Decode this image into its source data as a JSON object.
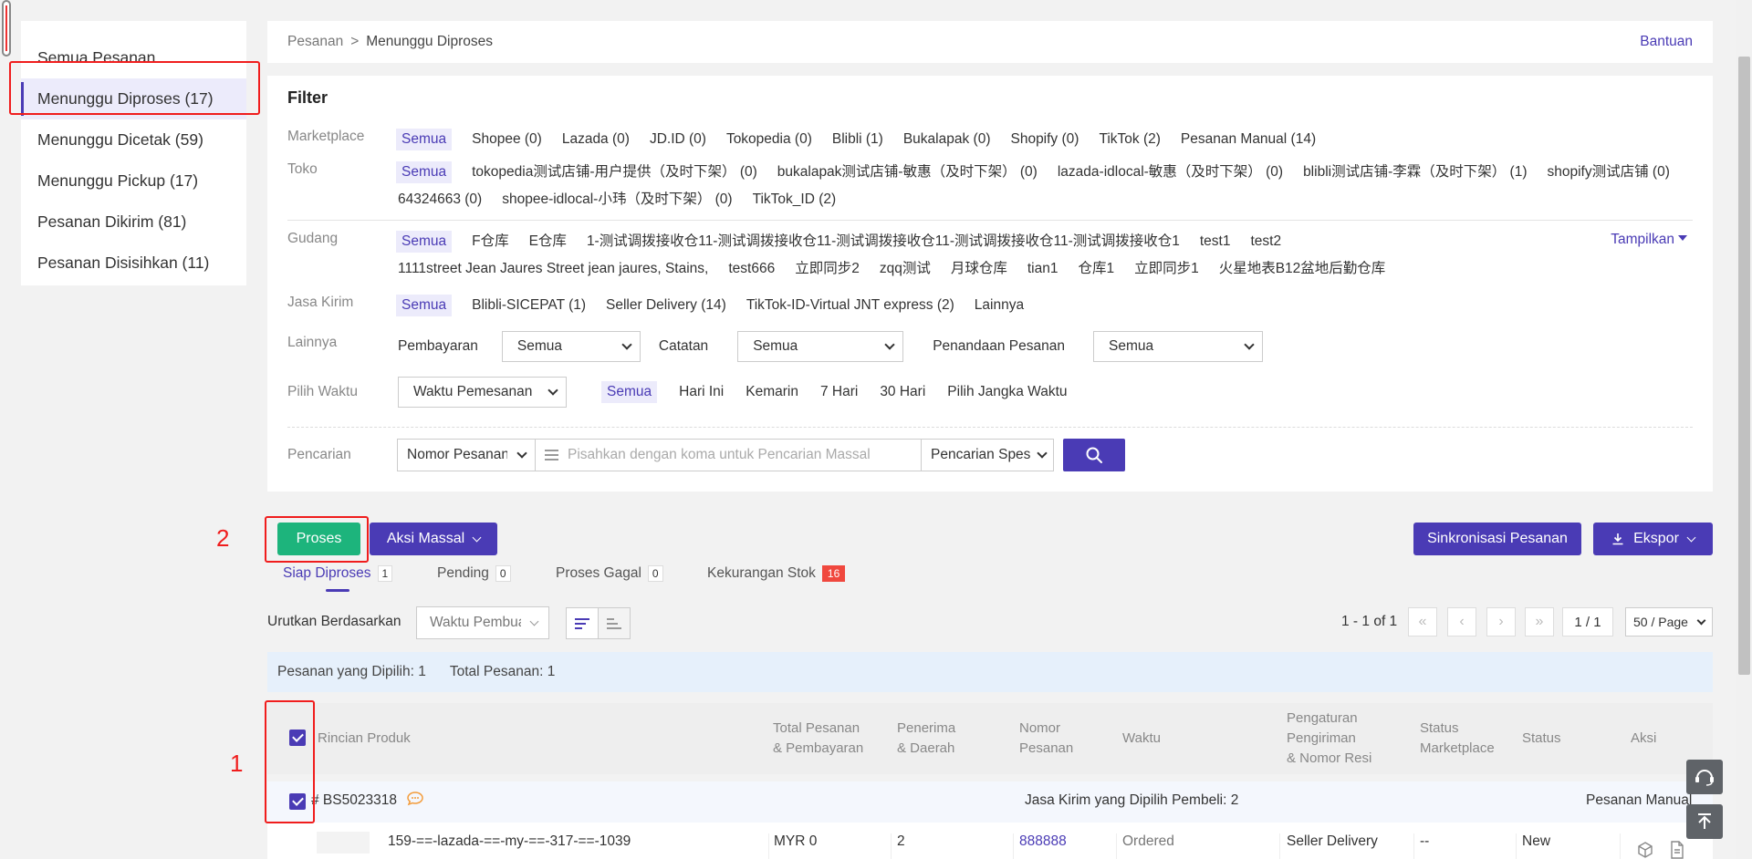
{
  "sidebar": {
    "items": [
      {
        "label": "Semua Pesanan"
      },
      {
        "label": "Menunggu Diproses (17)"
      },
      {
        "label": "Menunggu Dicetak (59)"
      },
      {
        "label": "Menunggu Pickup (17)"
      },
      {
        "label": "Pesanan Dikirim (81)"
      },
      {
        "label": "Pesanan Disisihkan (11)"
      }
    ],
    "active_index": 1
  },
  "breadcrumb": {
    "root": "Pesanan",
    "separator": ">",
    "current": "Menunggu Diproses",
    "help": "Bantuan"
  },
  "filter": {
    "title": "Filter",
    "marketplace": {
      "label": "Marketplace",
      "options": [
        "Semua",
        "Shopee (0)",
        "Lazada (0)",
        "JD.ID (0)",
        "Tokopedia (0)",
        "Blibli (1)",
        "Bukalapak (0)",
        "Shopify (0)",
        "TikTok (2)",
        "Pesanan Manual (14)"
      ]
    },
    "toko": {
      "label": "Toko",
      "options": [
        "Semua",
        "tokopedia测试店铺-用户提供（及时下架） (0)",
        "bukalapak测试店铺-敏惠（及时下架） (0)",
        "lazada-idlocal-敏惠（及时下架） (0)",
        "blibli测试店铺-李霖（及时下架） (1)",
        "shopify测试店铺 (0)",
        "64324663 (0)",
        "shopee-idlocal-小玮（及时下架） (0)",
        "TikTok_ID (2)"
      ]
    },
    "gudang": {
      "label": "Gudang",
      "options": [
        "Semua",
        "F仓库",
        "E仓库",
        "1-测试调拨接收仓11-测试调拨接收仓11-测试调拨接收仓11-测试调拨接收仓11-测试调拨接收仓1",
        "test1",
        "test2",
        "1111street Jean Jaures Street jean jaures, Stains,",
        "test666",
        "立即同步2",
        "zqq测试",
        "月球仓库",
        "tian1",
        "仓库1",
        "立即同步1",
        "火星地表B12盆地后勤仓库"
      ],
      "show_more": "Tampilkan"
    },
    "jasa_kirim": {
      "label": "Jasa Kirim",
      "options": [
        "Semua",
        "Blibli-SICEPAT (1)",
        "Seller Delivery (14)",
        "TikTok-ID-Virtual JNT express (2)",
        "Lainnya"
      ]
    },
    "lainnya": {
      "label": "Lainnya",
      "pembayaran_label": "Pembayaran",
      "pembayaran_value": "Semua",
      "catatan_label": "Catatan",
      "catatan_value": "Semua",
      "penandaan_label": "Penandaan Pesanan",
      "penandaan_value": "Semua"
    },
    "pilih_waktu": {
      "label": "Pilih Waktu",
      "type_value": "Waktu Pemesanan",
      "options": [
        "Semua",
        "Hari Ini",
        "Kemarin",
        "7 Hari",
        "30 Hari",
        "Pilih Jangka Waktu"
      ]
    },
    "pencarian": {
      "label": "Pencarian",
      "type_value": "Nomor Pesanan",
      "placeholder": "Pisahkan dengan koma untuk Pencarian Massal",
      "mode_value": "Pencarian Spesifik"
    }
  },
  "actions": {
    "proses": "Proses",
    "aksi_massal": "Aksi Massal",
    "sinkronisasi": "Sinkronisasi Pesanan",
    "ekspor": "Ekspor"
  },
  "annotations": {
    "n1": "1",
    "n2": "2"
  },
  "tabs": [
    {
      "label": "Siap Diproses",
      "count": "1"
    },
    {
      "label": "Pending",
      "count": "0"
    },
    {
      "label": "Proses Gagal",
      "count": "0"
    },
    {
      "label": "Kekurangan Stok",
      "count": "16"
    }
  ],
  "sort": {
    "label": "Urutkan Berdasarkan",
    "value": "Waktu Pembuatan"
  },
  "pager": {
    "range": "1 - 1 of 1",
    "current": "1 / 1",
    "per_page": "50 / Page"
  },
  "info": {
    "selected": "Pesanan yang Dipilih: 1",
    "total": "Total Pesanan: 1"
  },
  "table": {
    "headers": {
      "product": "Rincian Produk",
      "total_1": "Total Pesanan",
      "total_2": "& Pembayaran",
      "recv_1": "Penerima",
      "recv_2": "& Daerah",
      "no_1": "Nomor",
      "no_2": "Pesanan",
      "time": "Waktu",
      "ship_1": "Pengaturan",
      "ship_2": "Pengiriman",
      "ship_3": "& Nomor Resi",
      "mkt_1": "Status",
      "mkt_2": "Marketplace",
      "status": "Status",
      "action": "Aksi"
    },
    "group": {
      "id": "# BS5023318",
      "shipping_note": "Jasa Kirim yang Dipilih Pembeli: 2",
      "source": "Pesanan Manual"
    },
    "row": {
      "product": "159-==-lazada-==-my-==-317-==-1039",
      "total": "MYR 0",
      "receiver": "2",
      "order_no": "888888",
      "time": "Ordered",
      "shipping": "Seller Delivery",
      "mkt_status": "--",
      "status": "New"
    }
  },
  "colors": {
    "primary": "#4a3bb5",
    "proses_green": "#1db47c",
    "highlight_red": "#f01d1d",
    "badge_red": "#f0483e"
  }
}
